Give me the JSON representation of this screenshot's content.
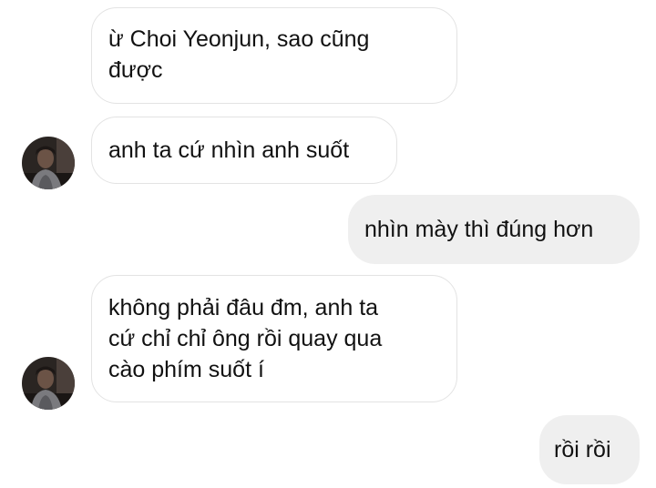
{
  "messages": [
    {
      "direction": "received",
      "text": "ừ Choi Yeonjun, sao cũng\nđược"
    },
    {
      "direction": "received",
      "text": "anh ta cứ nhìn anh suốt"
    },
    {
      "direction": "sent",
      "text": "nhìn mày thì đúng hơn"
    },
    {
      "direction": "received",
      "text": "không phải đâu đm, anh ta\ncứ chỉ chỉ ông rồi quay qua\ncào phím suốt í"
    },
    {
      "direction": "sent",
      "text": "rồi rồi"
    }
  ],
  "avatars": [
    {
      "icon": "contact-avatar-photo"
    },
    {
      "icon": "contact-avatar-photo"
    }
  ],
  "colors": {
    "background": "#ffffff",
    "received_bubble": "#ffffff",
    "received_border": "#e3e3e3",
    "sent_bubble": "#efefef",
    "text": "#111111"
  }
}
